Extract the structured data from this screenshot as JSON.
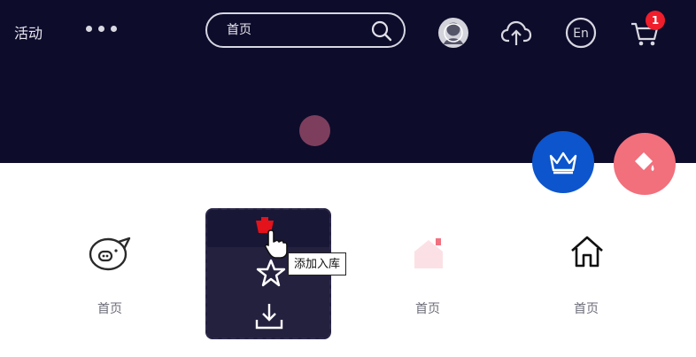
{
  "header": {
    "nav_activity": "活动",
    "search": {
      "placeholder": "首页"
    },
    "cart_badge": "1",
    "lang_label": "En"
  },
  "tiles": [
    {
      "label": "首页"
    },
    {
      "label": "首页"
    },
    {
      "label": "首页"
    }
  ],
  "popup": {
    "tooltip": "添加入库"
  },
  "colors": {
    "header_bg": "#0e0c2b",
    "vip_fab": "#0c55cc",
    "paint_fab": "#f26f7c",
    "badge": "#f01d2b",
    "popup_bg": "#24213f"
  }
}
